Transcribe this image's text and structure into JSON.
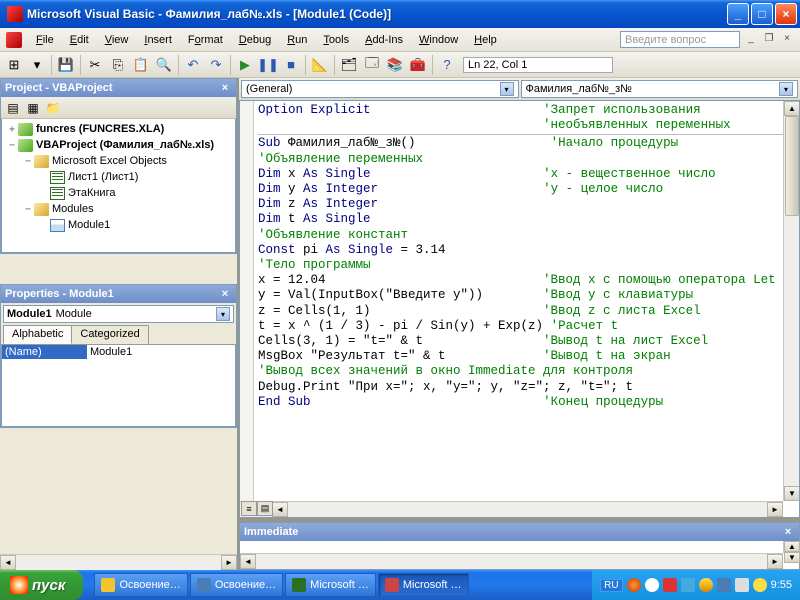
{
  "title": "Microsoft Visual Basic - Фамилия_лаб№.xls - [Module1 (Code)]",
  "menu": {
    "file": "File",
    "edit": "Edit",
    "view": "View",
    "insert": "Insert",
    "format": "Format",
    "debug": "Debug",
    "run": "Run",
    "tools": "Tools",
    "addins": "Add-Ins",
    "window": "Window",
    "help": "Help"
  },
  "help_placeholder": "Введите вопрос",
  "cursor": "Ln 22, Col 1",
  "project_panel": {
    "title": "Project - VBAProject",
    "items": {
      "funcres": "funcres (FUNCRES.XLA)",
      "vba": "VBAProject (Фамилия_лаб№.xls)",
      "excel_obj": "Microsoft Excel Objects",
      "sheet1": "Лист1 (Лист1)",
      "thisbook": "ЭтаКнига",
      "modules": "Modules",
      "module1": "Module1"
    }
  },
  "props": {
    "title": "Properties - Module1",
    "obj_bold": "Module1",
    "obj_rest": "Module",
    "tab_alpha": "Alphabetic",
    "tab_cat": "Categorized",
    "name_k": "(Name)",
    "name_v": "Module1"
  },
  "code_combo": {
    "left": "(General)",
    "right": "Фамилия_лаб№_з№"
  },
  "code": [
    {
      "t": "<kw>Option Explicit</kw>                       <cm>'Запрет использования</cm>"
    },
    {
      "t": "                                      <cm>'необъявленных переменных</cm>"
    },
    {
      "hr": true
    },
    {
      "t": "<kw>Sub</kw> Фамилия_лаб№_з№()                  <cm>'Начало процедуры</cm>"
    },
    {
      "t": "<cm>'Объявление переменных</cm>"
    },
    {
      "t": "<kw>Dim</kw> x <kw>As Single</kw>                       <cm>'x - вещественное число</cm>"
    },
    {
      "t": "<kw>Dim</kw> y <kw>As Integer</kw>                      <cm>'y - целое число</cm>"
    },
    {
      "t": "<kw>Dim</kw> z <kw>As Integer</kw>"
    },
    {
      "t": "<kw>Dim</kw> t <kw>As Single</kw>"
    },
    {
      "t": "<cm>'Объявление констант</cm>"
    },
    {
      "t": "<kw>Const</kw> pi <kw>As Single</kw> = 3.14"
    },
    {
      "t": "<cm>'Тело программы</cm>"
    },
    {
      "t": "x = 12.04                             <cm>'Ввод x с помощью оператора Let</cm>"
    },
    {
      "t": "y = Val(InputBox(\"Введите y\"))        <cm>'Ввод y с клавиатуры</cm>"
    },
    {
      "t": "z = Cells(1, 1)                       <cm>'Ввод z с листа Excel</cm>"
    },
    {
      "t": "t = x ^ (1 / 3) - pi / Sin(y) + Exp(z) <cm>'Расчет t</cm>"
    },
    {
      "t": "Cells(3, 1) = \"t=\" & t                <cm>'Вывод t на лист Excel</cm>"
    },
    {
      "t": "MsgBox \"Результат t=\" & t             <cm>'Вывод t на экран</cm>"
    },
    {
      "t": "<cm>'Вывод всех значений в окно Immediate для контроля</cm>"
    },
    {
      "t": "Debug.Print \"При x=\"; x, \"y=\"; y, \"z=\"; z, \"t=\"; t"
    },
    {
      "t": "<kw>End Sub</kw>                               <cm>'Конец процедуры</cm>"
    }
  ],
  "immediate_title": "Immediate",
  "taskbar": {
    "start": "пуск",
    "tasks": [
      "Освоение…",
      "Освоение…",
      "Microsoft …",
      "Microsoft …"
    ],
    "lang": "RU",
    "clock": "9:55"
  }
}
